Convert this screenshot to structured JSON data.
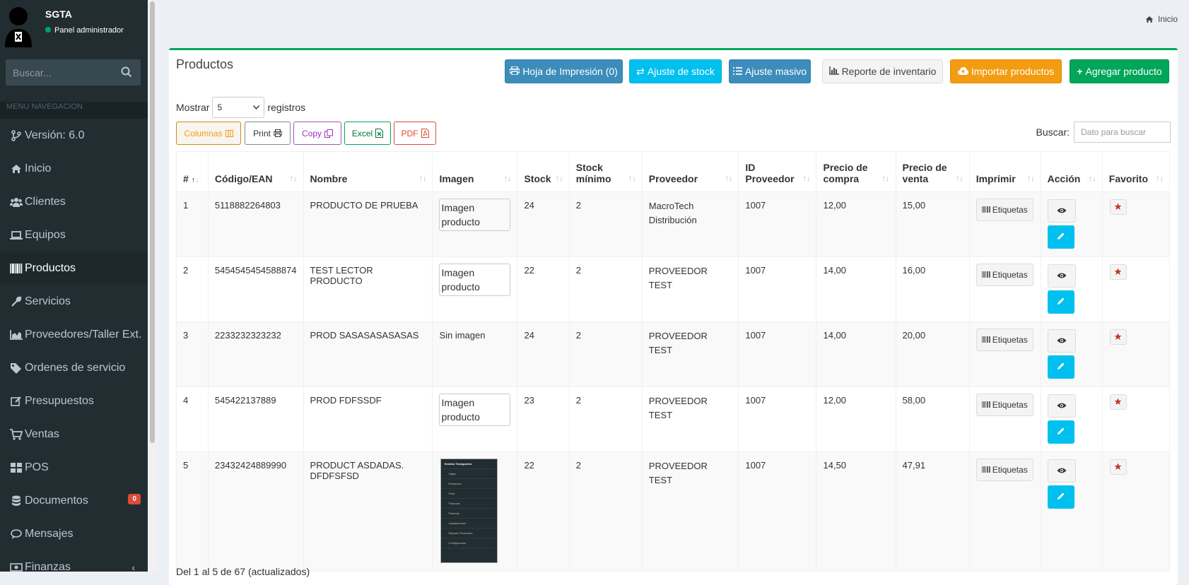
{
  "app": {
    "name": "SGTA",
    "status": "Panel administrador"
  },
  "sidebar": {
    "search_placeholder": "Buscar...",
    "header": "MENU NAVEGACION",
    "items": [
      {
        "label": "Versión: 6.0",
        "icon": "branch-icon"
      },
      {
        "label": "Inicio",
        "icon": "home-icon"
      },
      {
        "label": "Clientes",
        "icon": "users-icon"
      },
      {
        "label": "Equipos",
        "icon": "laptop-icon"
      },
      {
        "label": "Productos",
        "icon": "barcode-icon",
        "active": true
      },
      {
        "label": "Servicios",
        "icon": "wrench-icon"
      },
      {
        "label": "Proveedores/Taller Ext.",
        "icon": "chart-icon"
      },
      {
        "label": "Ordenes de servicio",
        "icon": "tags-icon"
      },
      {
        "label": "Presupuestos",
        "icon": "edit-icon"
      },
      {
        "label": "Ventas",
        "icon": "cart-icon"
      },
      {
        "label": "POS",
        "icon": "grid-icon"
      },
      {
        "label": "Documentos",
        "icon": "database-icon",
        "badge": "0"
      },
      {
        "label": "Mensajes",
        "icon": "comment-icon"
      },
      {
        "label": "Finanzas",
        "icon": "money-icon"
      }
    ]
  },
  "breadcrumb": {
    "label": "Inicio"
  },
  "page": {
    "title": "Productos",
    "buttons": {
      "print_sheet": "Hoja de Impresión (0)",
      "stock_adjust": "Ajuste de stock",
      "mass_adjust": "Ajuste masivo",
      "inventory_report": "Reporte de inventario",
      "import": "Importar productos",
      "add": "Agregar producto"
    },
    "length": {
      "prefix": "Mostrar",
      "value": "5",
      "suffix": "registros"
    },
    "export": {
      "columns": "Columnas",
      "print": "Print",
      "copy": "Copy",
      "excel": "Excel",
      "pdf": "PDF"
    },
    "search": {
      "label": "Buscar:",
      "placeholder": "Dato para buscar"
    },
    "info": "Del 1 al 5 de 67 (actualizados)"
  },
  "table": {
    "headers": [
      "#",
      "Código/EAN",
      "Nombre",
      "Imagen",
      "Stock",
      "Stock mínimo",
      "Proveedor",
      "ID Proveedor",
      "Precio de compra",
      "Precio de venta",
      "Imprimir",
      "Acción",
      "Favorito"
    ],
    "image_alt": "Imagen producto",
    "no_image": "Sin imagen",
    "label_button": "Etiquetas",
    "rows": [
      {
        "n": "1",
        "ean": "5118882264803",
        "name": "PRODUCTO DE PRUEBA",
        "img": "alt",
        "stock": "24",
        "min": "2",
        "prov": "MacroTech Distribución",
        "pid": "1007",
        "buy": "12,00",
        "sell": "15,00"
      },
      {
        "n": "2",
        "ean": "5454545454588874",
        "name": "TEST LECTOR PRODUCTO",
        "img": "alt",
        "stock": "22",
        "min": "2",
        "prov": "PROVEEDOR TEST",
        "pid": "1007",
        "buy": "14,00",
        "sell": "16,00"
      },
      {
        "n": "3",
        "ean": "2233232323232",
        "name": "PROD SASASASASASAS",
        "img": "none",
        "stock": "24",
        "min": "2",
        "prov": "PROVEEDOR TEST",
        "pid": "1007",
        "buy": "14,00",
        "sell": "20,00"
      },
      {
        "n": "4",
        "ean": "545422137889",
        "name": "PROD FDFSSDF",
        "img": "alt",
        "stock": "23",
        "min": "2",
        "prov": "PROVEEDOR TEST",
        "pid": "1007",
        "buy": "12,00",
        "sell": "58,00"
      },
      {
        "n": "5",
        "ean": "23432424889990",
        "name": "PRODUCT ASDADAS. DFDFSFSD",
        "img": "thumb",
        "stock": "22",
        "min": "2",
        "prov": "PROVEEDOR TEST",
        "pid": "1007",
        "buy": "14,50",
        "sell": "47,91"
      }
    ]
  },
  "thumbnail_menu": [
    "Gestión Transportes",
    "Viajes",
    "Empresas",
    "Flota",
    "Finanzas",
    "Facturas",
    "Liquidaciones",
    "Reporte Financiero",
    "Configuración"
  ],
  "colors": {
    "sidebar": "#222d32",
    "success": "#00a65a",
    "info": "#00c0ef",
    "primary": "#3c8dbc",
    "warning": "#f39c12",
    "danger": "#dd4b39"
  }
}
